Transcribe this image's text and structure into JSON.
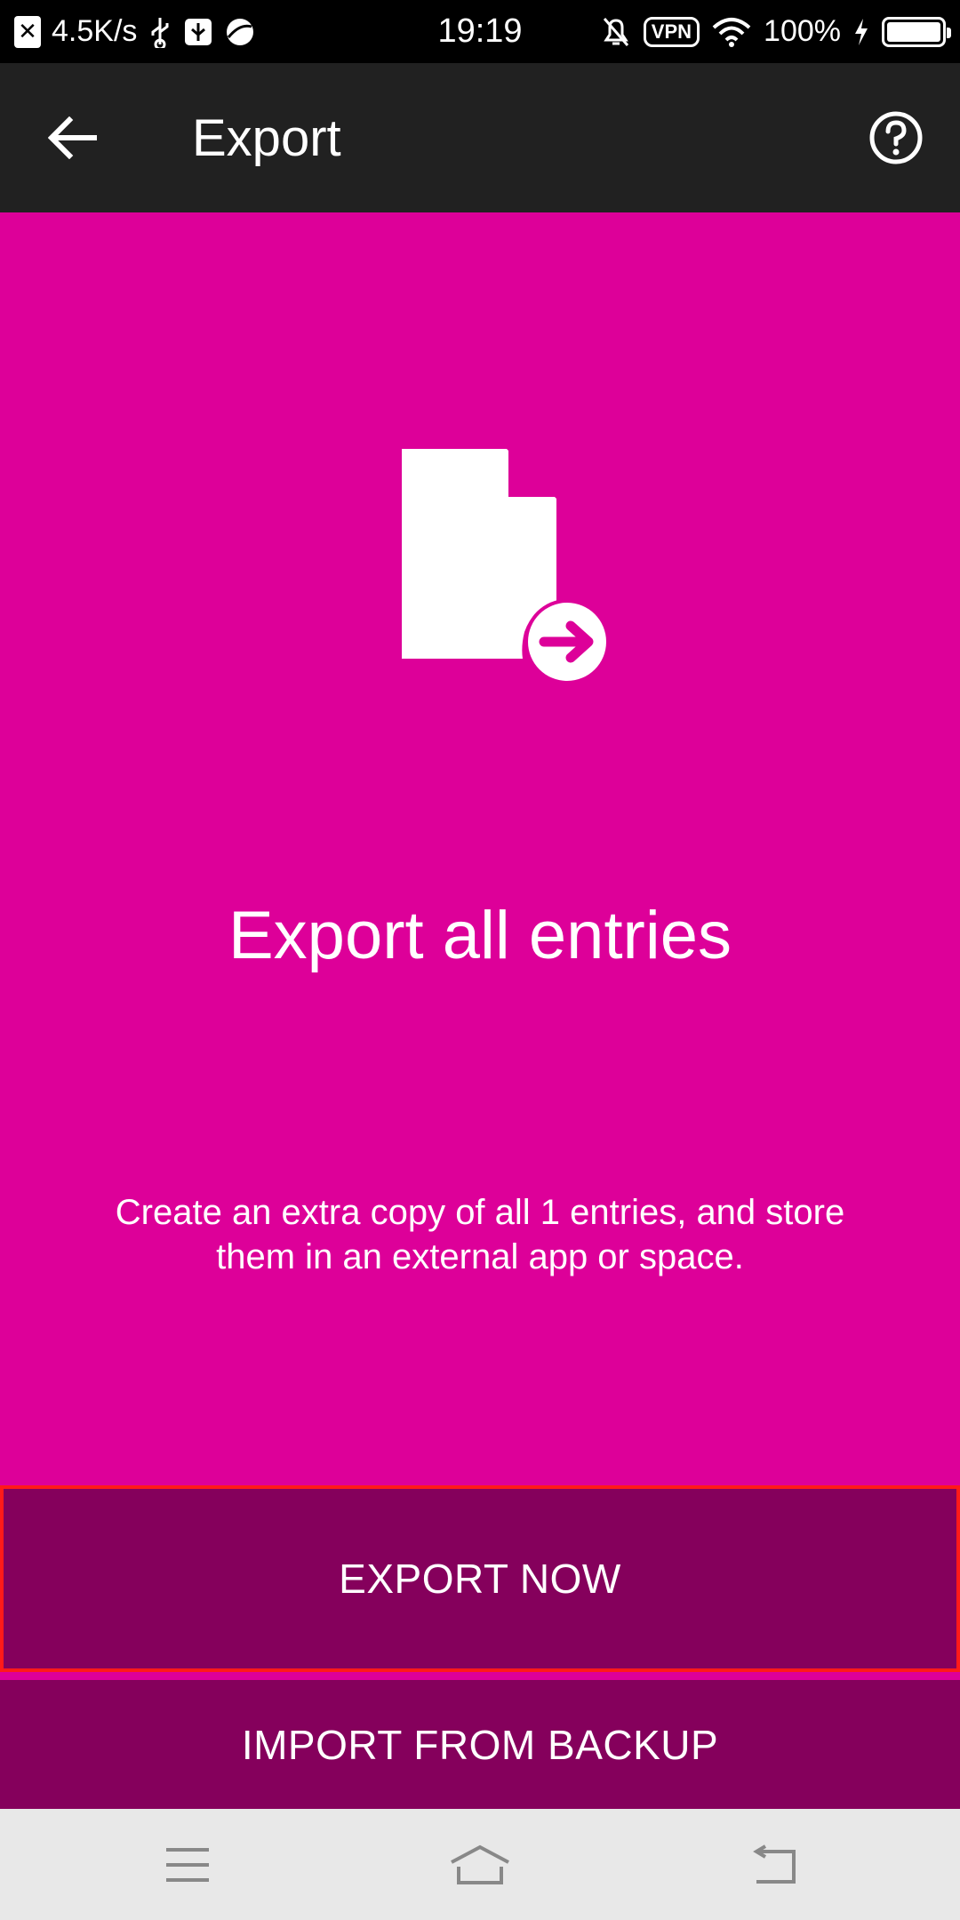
{
  "status_bar": {
    "speed": "4.5K/s",
    "time": "19:19",
    "vpn": "VPN",
    "battery": "100%"
  },
  "app_bar": {
    "title": "Export"
  },
  "main": {
    "headline": "Export all entries",
    "description": "Create an extra copy of all 1 entries, and store them in an external app or space."
  },
  "buttons": {
    "export_now": "EXPORT NOW",
    "import_backup": "IMPORT FROM BACKUP"
  },
  "colors": {
    "accent": "#dd0099",
    "button": "#85005c",
    "app_bar": "#212121",
    "highlight_border": "#ff1a1a"
  },
  "icons": {
    "back": "arrow-left-icon",
    "help": "help-circle-icon",
    "illustration": "file-export-icon",
    "nav_menu": "menu-lines-icon",
    "nav_home": "home-icon",
    "nav_back": "return-arrow-icon"
  }
}
